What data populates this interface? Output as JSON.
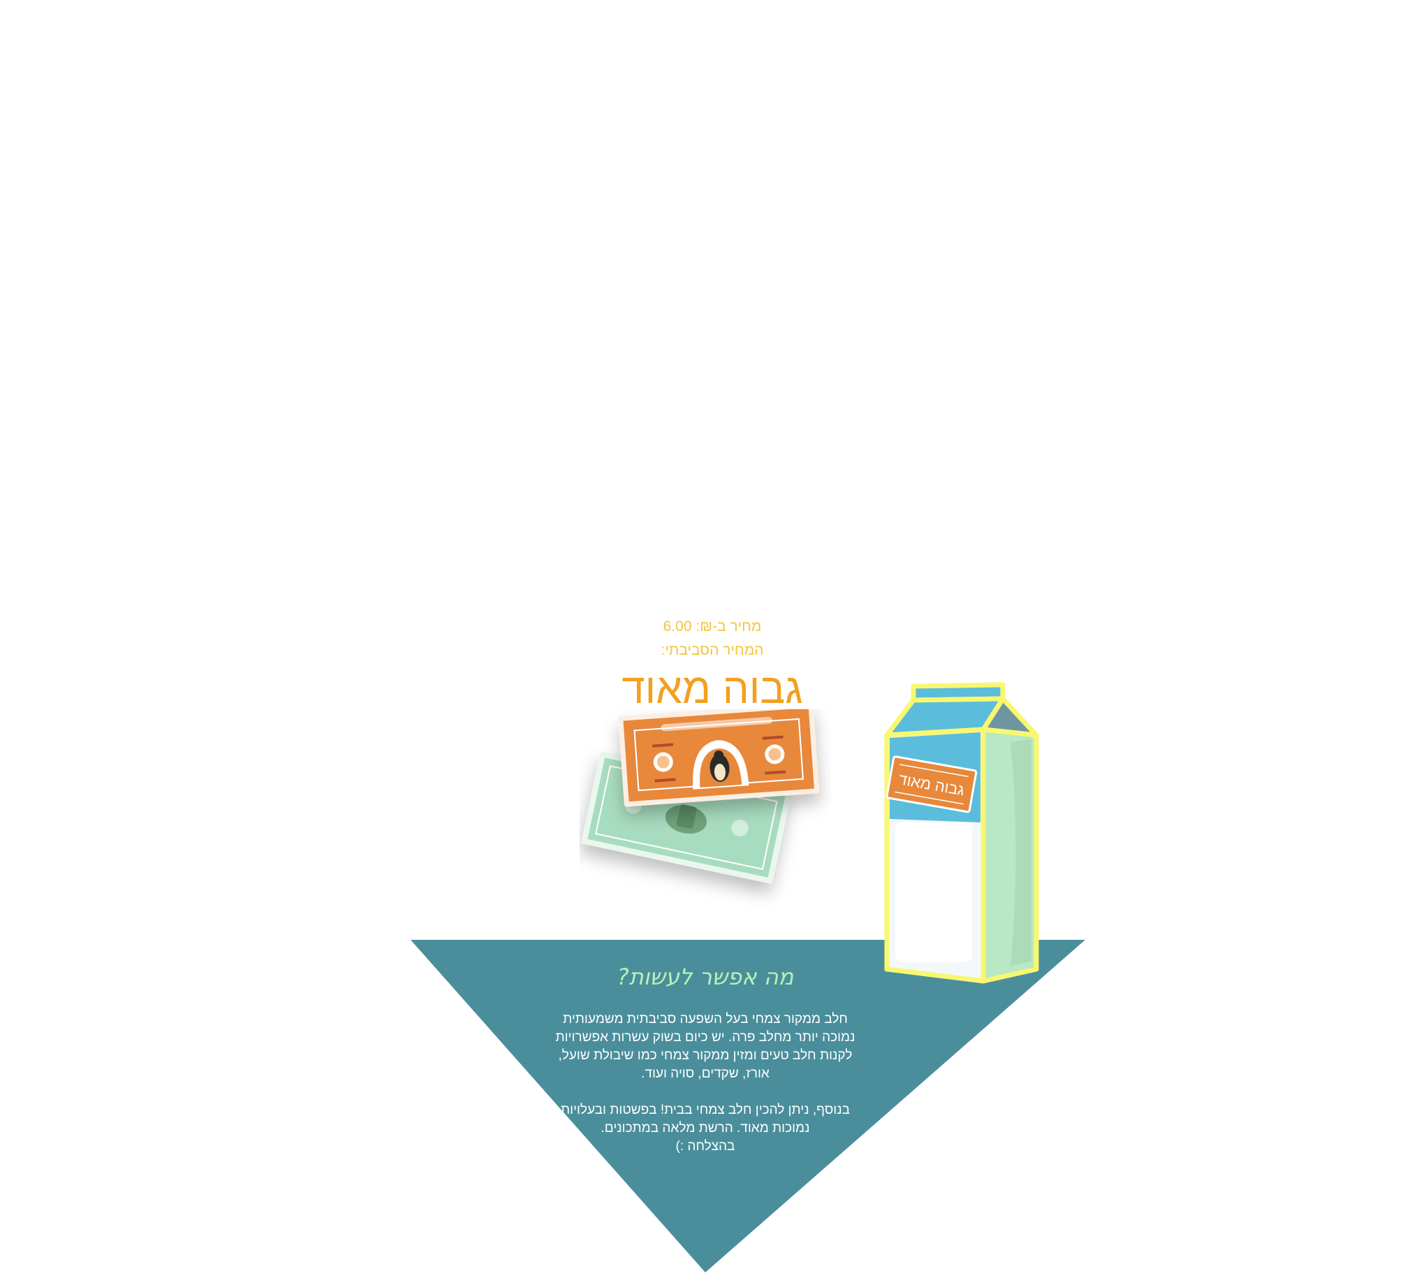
{
  "price": {
    "label": "מחיר ב-₪:",
    "value": "6.00"
  },
  "environmental": {
    "label": "המחיר הסביבתי:",
    "value": "גבוה מאוד"
  },
  "carton_tag": "גבוה מאוד",
  "info": {
    "heading": "מה אפשר לעשות?",
    "paragraph_1": "חלב ממקור צמחי בעל השפעה סביבתית משמעותית\nנמוכה יותר מחלב פרה. יש כיום בשוק עשרות אפשרויות\nלקנות חלב טעים ומזין ממקור צמחי כמו שיבולת שועל,\nאורז, שקדים, סויה ועוד.",
    "paragraph_2": "בנוסף, ניתן להכין חלב צמחי בבית! בפשטות ובעלויות\nנמוכות מאוד. הרשת מלאה במתכונים.",
    "signoff": "בהצלחה :)"
  },
  "colors": {
    "accent_yellow": "#f4c43c",
    "accent_orange": "#f2a01f",
    "triangle_teal": "#4a8e9c",
    "heading_green": "#b8f0b8",
    "bill_orange": "#e8883a",
    "bill_green": "#a8dcc0",
    "carton_blue": "#5bbcdc",
    "carton_green": "#b8e8c4",
    "carton_outline": "#f8f870"
  },
  "icons": {
    "bills": "money-bills-illustration",
    "carton": "milk-carton-illustration"
  }
}
